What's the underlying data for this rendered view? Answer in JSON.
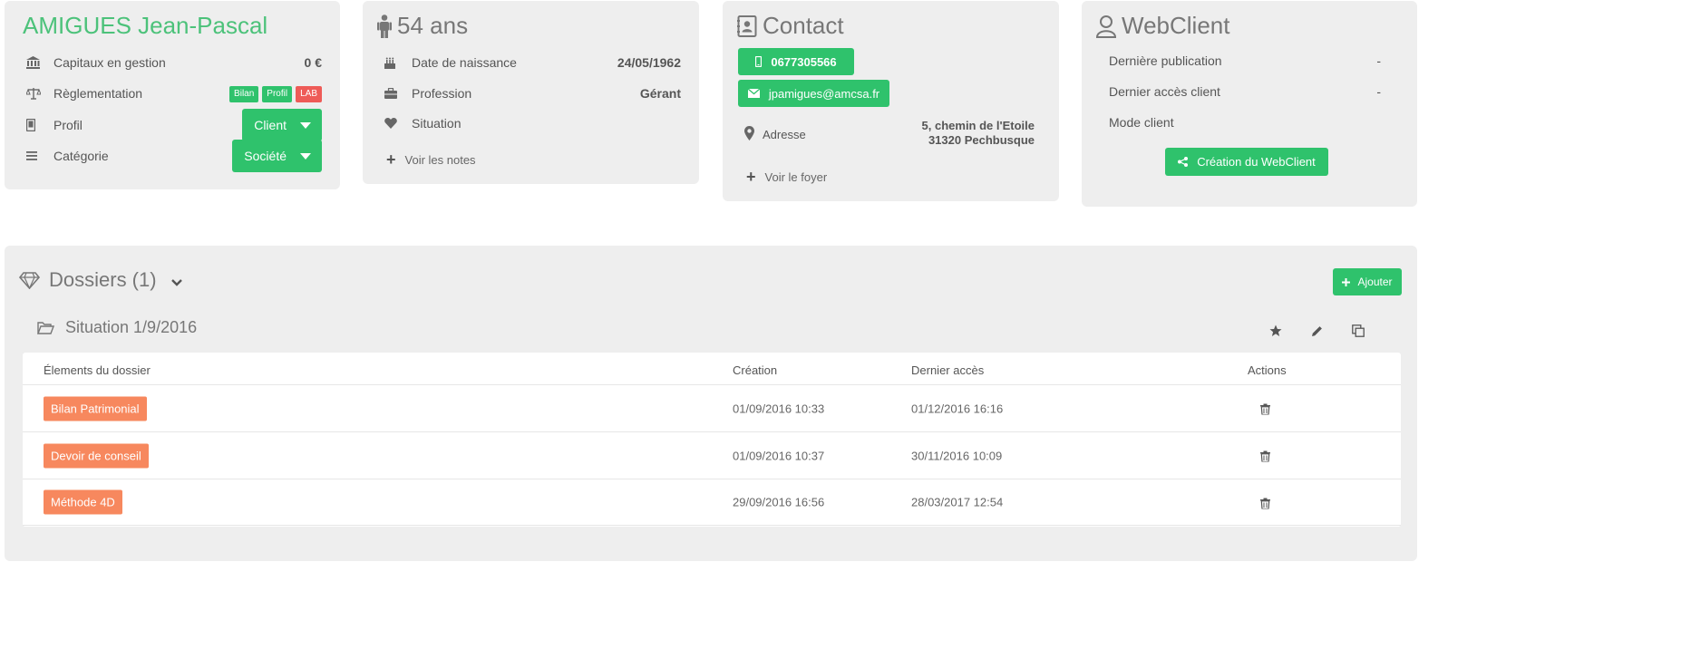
{
  "identity": {
    "name": "AMIGUES Jean-Pascal",
    "rows": [
      {
        "label": "Capitaux en gestion",
        "value": "0 €",
        "icon": "bank-icon"
      },
      {
        "label": "Règlementation",
        "icon": "scales-icon",
        "badges": [
          "Bilan",
          "Profil",
          "LAB"
        ]
      },
      {
        "label": "Profil",
        "icon": "phone-icon",
        "dropdown": "Client"
      },
      {
        "label": "Catégorie",
        "icon": "menu-icon",
        "dropdown": "Société"
      }
    ]
  },
  "age": {
    "title": "54 ans",
    "rows": [
      {
        "label": "Date de naissance",
        "value": "24/05/1962",
        "icon": "cake-icon"
      },
      {
        "label": "Profession",
        "value": "Gérant",
        "icon": "briefcase-icon"
      },
      {
        "label": "Situation",
        "value": "",
        "icon": "heart-icon"
      }
    ],
    "notes_link": "Voir les notes"
  },
  "contact": {
    "title": "Contact",
    "phone": "0677305566",
    "email": "jpamigues@amcsa.fr",
    "address_label": "Adresse",
    "address_line1": "5, chemin de l'Etoile",
    "address_line2": "31320 Pechbusque",
    "foyer_link": "Voir le foyer"
  },
  "webclient": {
    "title": "WebClient",
    "rows": [
      {
        "label": "Dernière publication",
        "value": "-"
      },
      {
        "label": "Dernier accès client",
        "value": "-"
      },
      {
        "label": "Mode client",
        "value": ""
      }
    ],
    "create_button": "Création du WebClient"
  },
  "dossiers": {
    "title": "Dossiers (1)",
    "add_button": "Ajouter",
    "situation_title": "Situation 1/9/2016",
    "columns": [
      "Élements du dossier",
      "Création",
      "Dernier accès",
      "Actions"
    ],
    "rows": [
      {
        "element": "Bilan Patrimonial",
        "created": "01/09/2016 10:33",
        "last_access": "01/12/2016 16:16"
      },
      {
        "element": "Devoir de conseil",
        "created": "01/09/2016 10:37",
        "last_access": "30/11/2016 10:09"
      },
      {
        "element": "Méthode 4D",
        "created": "29/09/2016 16:56",
        "last_access": "28/03/2017 12:54"
      }
    ]
  },
  "colors": {
    "accent_green": "#2fc26c",
    "name_green": "#4cc27a",
    "orange": "#f7885e",
    "red": "#ee5b57",
    "card_bg": "#eeeeee"
  }
}
